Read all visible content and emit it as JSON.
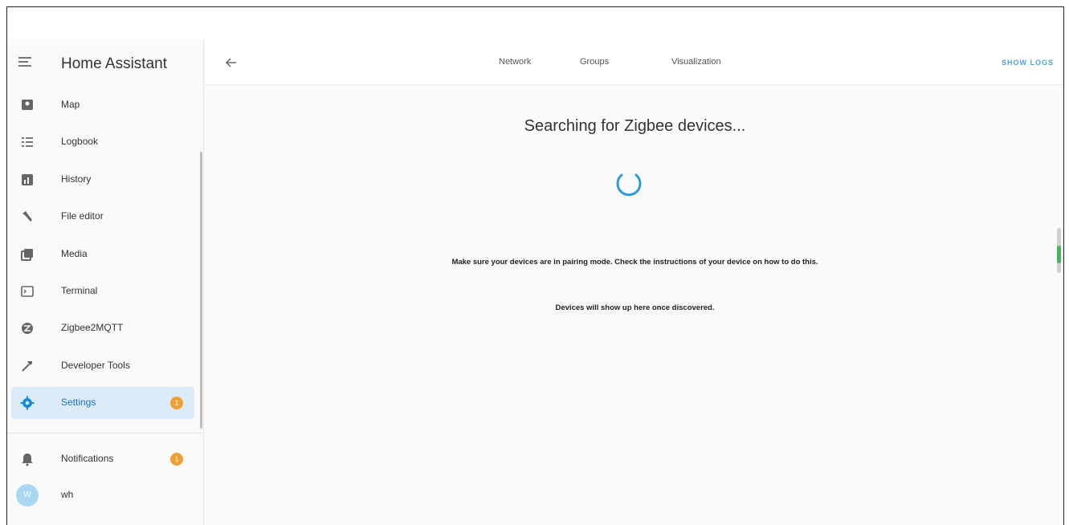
{
  "sidebar": {
    "title": "Home Assistant",
    "items": [
      {
        "label": "Map",
        "icon": "map-icon"
      },
      {
        "label": "Logbook",
        "icon": "logbook-icon"
      },
      {
        "label": "History",
        "icon": "history-icon"
      },
      {
        "label": "File editor",
        "icon": "wrench-icon"
      },
      {
        "label": "Media",
        "icon": "media-icon"
      },
      {
        "label": "Terminal",
        "icon": "terminal-icon"
      },
      {
        "label": "Zigbee2MQTT",
        "icon": "zigbee-icon"
      },
      {
        "label": "Developer Tools",
        "icon": "hammer-icon"
      },
      {
        "label": "Settings",
        "icon": "gear-icon",
        "badge": "1",
        "active": true
      }
    ],
    "notifications": {
      "label": "Notifications",
      "icon": "bell-icon",
      "badge": "1"
    },
    "user": {
      "initials": "W",
      "label": "wh"
    }
  },
  "toolbar": {
    "tabs": [
      "Network",
      "Groups",
      "Visualization"
    ],
    "show_logs": "SHOW LOGS"
  },
  "content": {
    "heading": "Searching for Zigbee devices...",
    "message_pairing": "Make sure your devices are in pairing mode. Check the instructions of your device on how to do this.",
    "message_discovered": "Devices will show up here once discovered."
  },
  "colors": {
    "accent": "#03a9f4",
    "active_bg": "#dcebf8",
    "badge": "#f0a030",
    "spinner": "#2e9ad6"
  }
}
